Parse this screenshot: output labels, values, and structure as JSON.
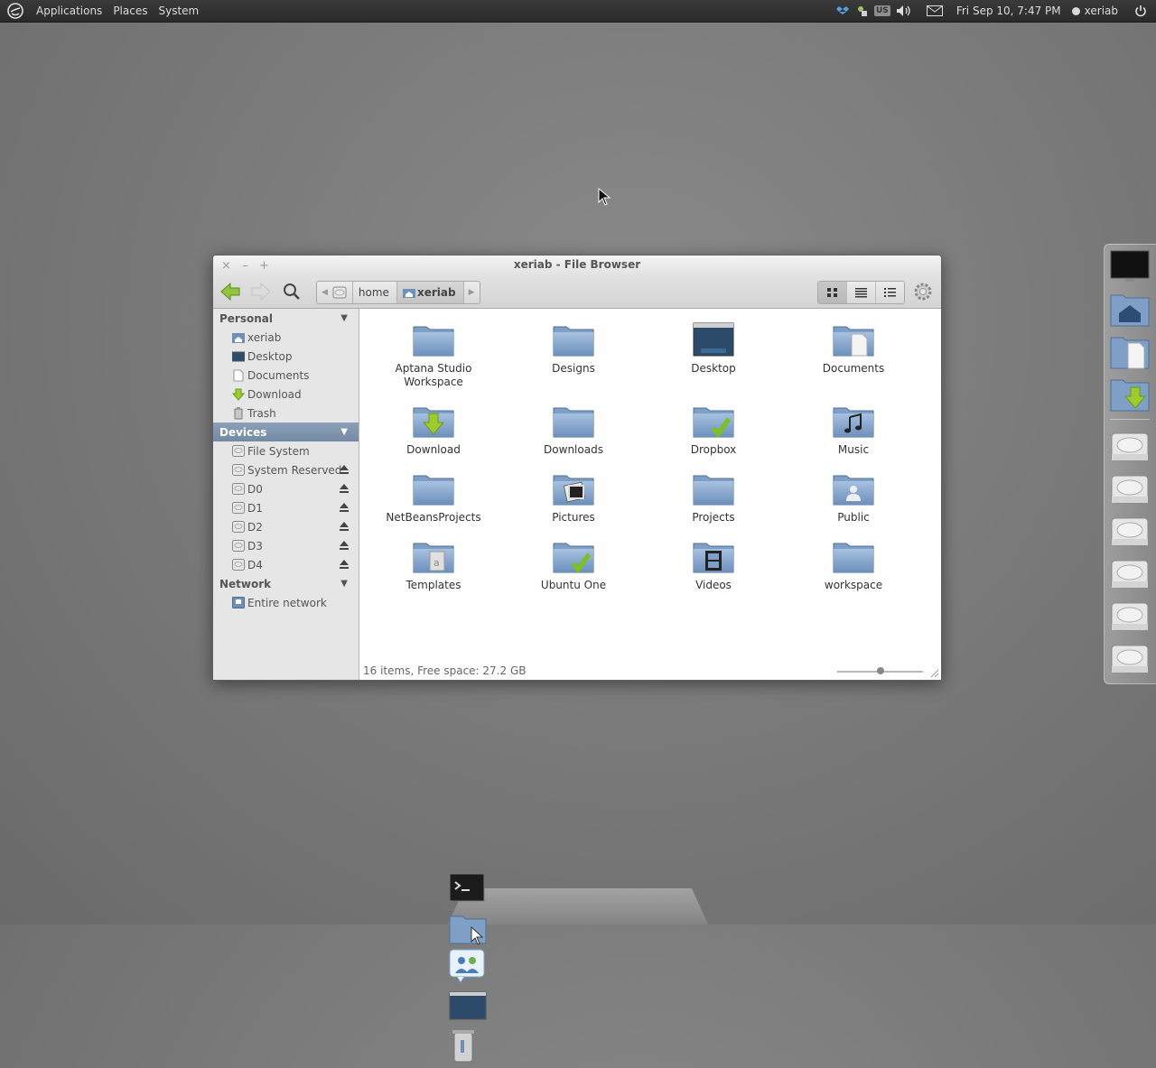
{
  "top_panel": {
    "menus": [
      "Applications",
      "Places",
      "System"
    ],
    "keyboard_layout": "US",
    "clock": "Fri Sep 10,  7:47 PM",
    "user": "xeriab"
  },
  "window": {
    "title": "xeriab - File Browser",
    "controls": [
      "×",
      "–",
      "+"
    ],
    "path": [
      "home",
      "xeriab"
    ],
    "sidebar": {
      "personal_title": "Personal",
      "personal": [
        "xeriab",
        "Desktop",
        "Documents",
        "Download",
        "Trash"
      ],
      "devices_title": "Devices",
      "devices": [
        "File System",
        "System Reserved",
        "D0",
        "D1",
        "D2",
        "D3",
        "D4"
      ],
      "network_title": "Network",
      "network": [
        "Entire network"
      ]
    },
    "items": [
      {
        "label": "Aptana Studio Workspace",
        "icon": "folder"
      },
      {
        "label": "Designs",
        "icon": "folder"
      },
      {
        "label": "Desktop",
        "icon": "desktop-folder"
      },
      {
        "label": "Documents",
        "icon": "documents-folder"
      },
      {
        "label": "Download",
        "icon": "download-folder"
      },
      {
        "label": "Downloads",
        "icon": "folder"
      },
      {
        "label": "Dropbox",
        "icon": "dropbox-folder"
      },
      {
        "label": "Music",
        "icon": "music-folder"
      },
      {
        "label": "NetBeansProjects",
        "icon": "folder"
      },
      {
        "label": "Pictures",
        "icon": "pictures-folder"
      },
      {
        "label": "Projects",
        "icon": "folder"
      },
      {
        "label": "Public",
        "icon": "public-folder"
      },
      {
        "label": "Templates",
        "icon": "templates-folder"
      },
      {
        "label": "Ubuntu One",
        "icon": "ubuntuone-folder"
      },
      {
        "label": "Videos",
        "icon": "videos-folder"
      },
      {
        "label": "workspace",
        "icon": "folder"
      }
    ],
    "status": "16 items, Free space: 27.2 GB"
  },
  "colors": {
    "folder_blue": "#7f9fc6",
    "sidebar_selected": "#7f93ad",
    "check_green": "#7cc21d"
  }
}
